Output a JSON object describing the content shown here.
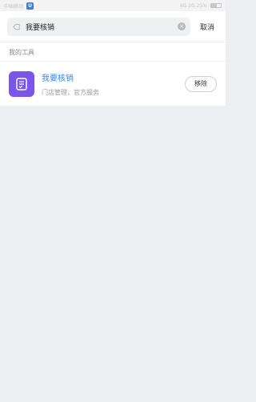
{
  "status_bar": {
    "left_text": "中国移动",
    "app_badge": "U",
    "right_text": "4G 2G 25%",
    "battery_level": 0.6
  },
  "search": {
    "value": "我要核销",
    "cancel_label": "取消"
  },
  "section": {
    "title": "我的工具"
  },
  "tool": {
    "name": "我要核销",
    "description": "门店管理，官方服务",
    "remove_label": "移除",
    "icon_color": "#7a55ea"
  },
  "colors": {
    "accent": "#3d86e8",
    "background": "#eeeff3"
  }
}
